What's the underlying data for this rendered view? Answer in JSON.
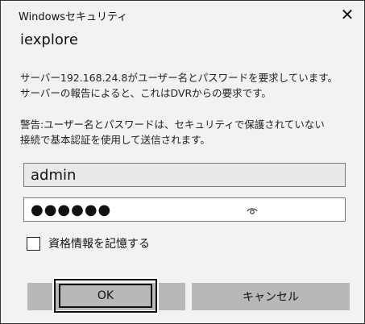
{
  "dialog": {
    "title": "Windowsセキュリティ",
    "close_glyph": "✕",
    "app_name": "iexplore",
    "message1_line1": "サーバー192.168.24.8がユーザー名とパスワードを要求しています。",
    "message1_line2": "サーバーの報告によると、これはDVRからの要求です。",
    "message2_line1": "警告:ユーザー名とパスワードは、セキュリティで保護されていない",
    "message2_line2": "接続で基本認証を使用して送信されます。"
  },
  "form": {
    "username_value": "admin",
    "password_masked": "●●●●●●",
    "reveal_icon": "eye-icon",
    "remember_label": "資格情報を記憶する",
    "remember_checked": false
  },
  "buttons": {
    "ok_label": "OK",
    "cancel_label": "キャンセル"
  },
  "colors": {
    "dialog_bg": "#f2f2f2",
    "button_bg": "#b8b8b8",
    "username_bg": "#e9e9e9"
  }
}
